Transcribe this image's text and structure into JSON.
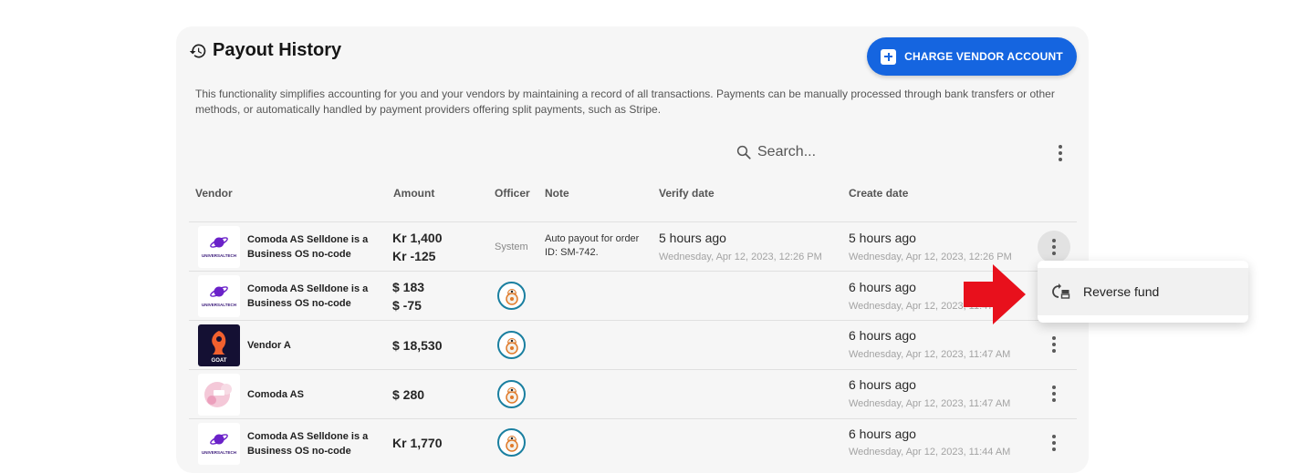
{
  "header": {
    "title": "Payout History",
    "charge_button": "CHARGE VENDOR ACCOUNT",
    "description": "This functionality simplifies accounting for you and your vendors by maintaining a record of all transactions. Payments can be manually processed through bank transfers or other methods, or automatically handled by payment providers offering split payments, such as Stripe."
  },
  "search": {
    "placeholder": "Search..."
  },
  "columns": {
    "vendor": "Vendor",
    "amount": "Amount",
    "officer": "Officer",
    "note": "Note",
    "verify_date": "Verify date",
    "create_date": "Create date"
  },
  "rows": [
    {
      "vendor": "Comoda AS Selldone is a Business OS no-code",
      "logo": "universaltech",
      "amount_1": "Kr 1,400",
      "amount_2": "Kr -125",
      "officer": "System",
      "note": "Auto payout for order ID: SM-742.",
      "verify_rel": "5 hours ago",
      "verify_abs": "Wednesday, Apr 12, 2023, 12:26 PM",
      "create_rel": "5 hours ago",
      "create_abs": "Wednesday, Apr 12, 2023, 12:26 PM"
    },
    {
      "vendor": "Comoda AS Selldone is a Business OS no-code",
      "logo": "universaltech",
      "amount_1": "$ 183",
      "amount_2": "$ -75",
      "officer": "avatar",
      "create_rel": "6 hours ago",
      "create_abs": "Wednesday, Apr 12, 2023, 11:47 AM"
    },
    {
      "vendor": "Vendor A",
      "logo": "goat",
      "amount_1": "$ 18,530",
      "officer": "avatar",
      "create_rel": "6 hours ago",
      "create_abs": "Wednesday, Apr 12, 2023, 11:47 AM"
    },
    {
      "vendor": "Comoda AS",
      "logo": "pink-splash",
      "amount_1": "$ 280",
      "officer": "avatar",
      "create_rel": "6 hours ago",
      "create_abs": "Wednesday, Apr 12, 2023, 11:47 AM"
    },
    {
      "vendor": "Comoda AS Selldone is a Business OS no-code",
      "logo": "universaltech",
      "amount_1": "Kr 1,770",
      "officer": "avatar",
      "create_rel": "6 hours ago",
      "create_abs": "Wednesday, Apr 12, 2023, 11:44 AM"
    }
  ],
  "context_menu": {
    "reverse_fund": "Reverse fund"
  },
  "logos": {
    "universaltech_text": "UNIVERSALTECH",
    "goat_text": "GOAT"
  },
  "colors": {
    "accent": "#1565e0",
    "annotation_arrow": "#e8101c",
    "officer_ring": "#1a7fa0"
  },
  "icons": [
    "history-icon",
    "plus-icon",
    "search-icon",
    "more-vert-icon",
    "reverse-fund-icon"
  ]
}
